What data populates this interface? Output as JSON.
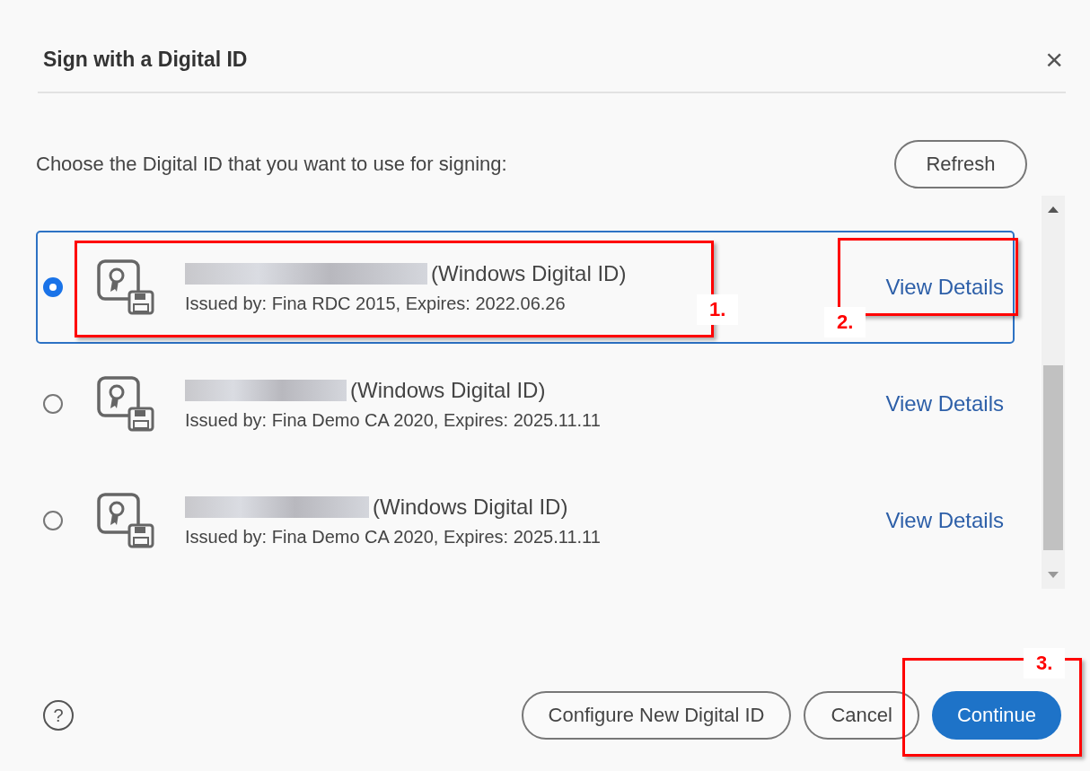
{
  "dialog": {
    "title": "Sign with a Digital ID",
    "close": "×"
  },
  "prompt": "Choose the Digital ID that you want to use for signing:",
  "refresh_button": "Refresh",
  "ids": [
    {
      "type": "(Windows Digital ID)",
      "issuer": "Issued by: Fina RDC 2015, Expires: 2022.06.26",
      "link": "View Details",
      "selected": true
    },
    {
      "type": "(Windows Digital ID)",
      "issuer": "Issued by: Fina Demo CA 2020, Expires: 2025.11.11",
      "link": "View Details",
      "selected": false
    },
    {
      "type": "(Windows Digital ID)",
      "issuer": "Issued by: Fina Demo CA 2020, Expires: 2025.11.11",
      "link": "View Details",
      "selected": false
    }
  ],
  "footer": {
    "help": "?",
    "buttons": [
      {
        "label": "Configure New Digital ID",
        "kind": "outline"
      },
      {
        "label": "Cancel",
        "kind": "outline"
      },
      {
        "label": "Continue",
        "kind": "primary"
      }
    ]
  },
  "annotations": [
    {
      "label": "1."
    },
    {
      "label": "2."
    },
    {
      "label": "3."
    }
  ]
}
